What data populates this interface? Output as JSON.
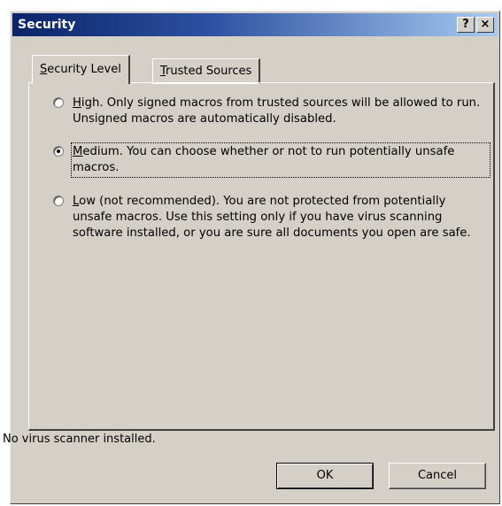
{
  "window": {
    "title": "Security",
    "help_glyph": "?",
    "close_glyph": "×"
  },
  "tabs": [
    {
      "label_key": "S",
      "label_rest": "ecurity Level",
      "active": true
    },
    {
      "label_key": "T",
      "label_rest": "rusted Sources",
      "active": false
    }
  ],
  "options": [
    {
      "key": "H",
      "rest": "igh. Only signed macros from trusted sources will be allowed to run. Unsigned macros are automatically disabled.",
      "selected": false
    },
    {
      "key": "M",
      "rest": "edium. You can choose whether or not to run potentially unsafe macros.",
      "selected": true
    },
    {
      "key": "L",
      "rest": "ow (not recommended). You are not protected from potentially unsafe macros. Use this setting only if you have virus scanning software installed, or you are sure all documents you open are safe.",
      "selected": false
    }
  ],
  "status": "No virus scanner installed.",
  "buttons": {
    "ok": "OK",
    "cancel": "Cancel"
  }
}
